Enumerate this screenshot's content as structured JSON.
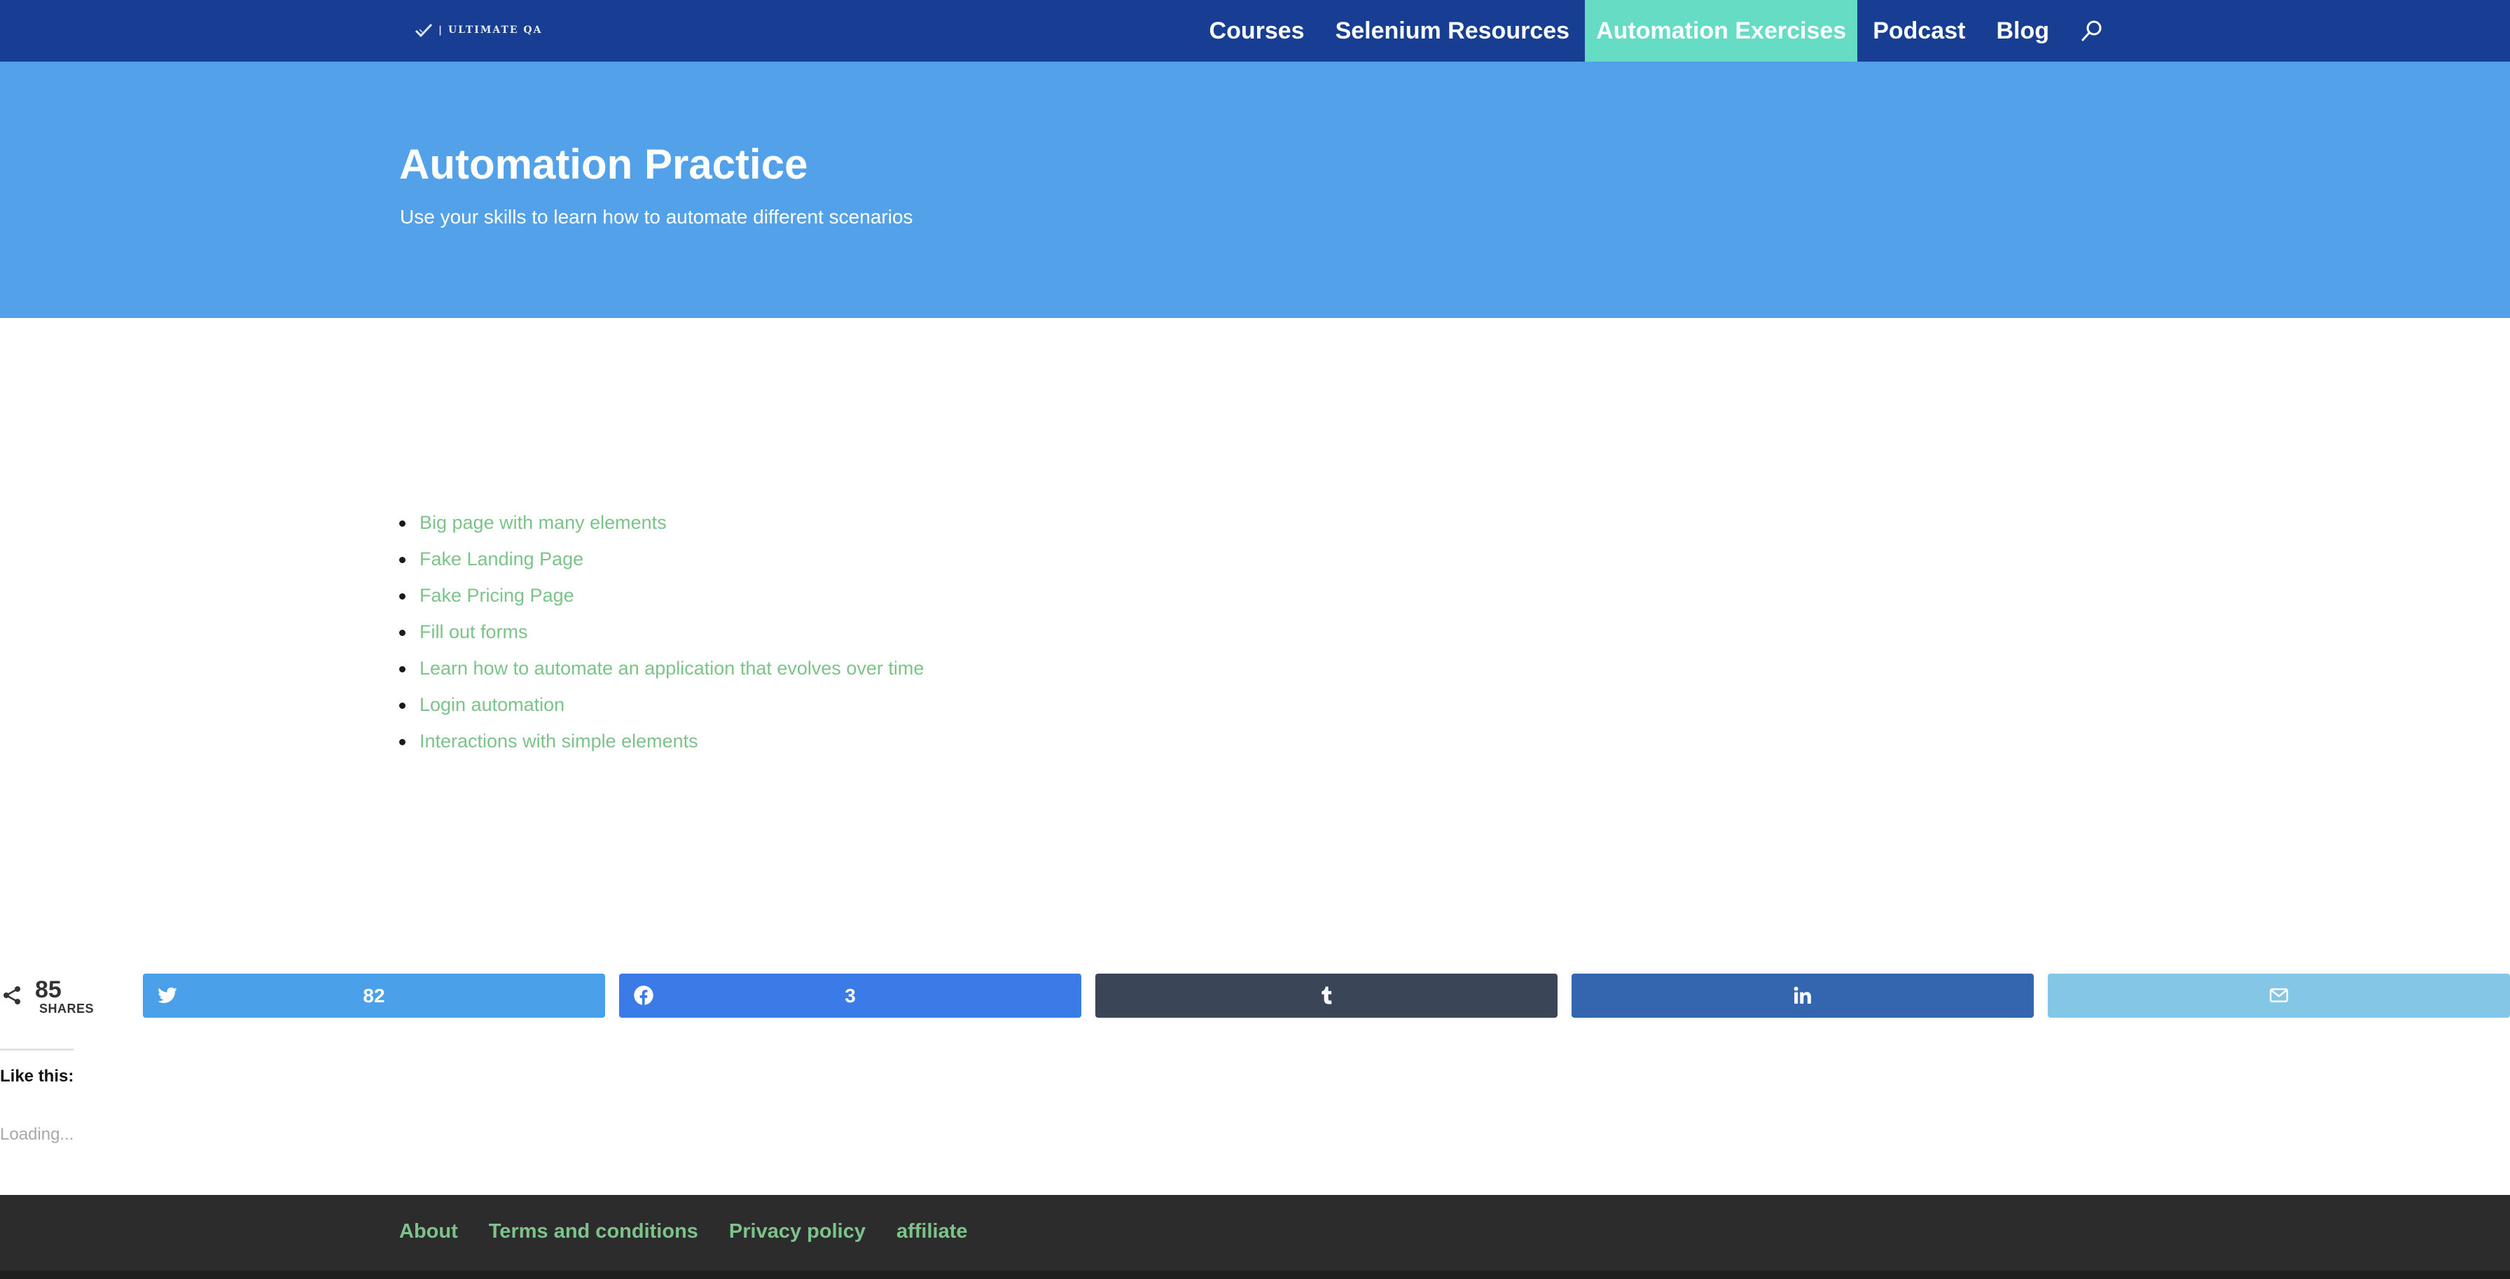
{
  "header": {
    "logo_text": "| ULTIMATE QA",
    "nav": [
      "Courses",
      "Selenium Resources",
      "Automation Exercises",
      "Podcast",
      "Blog"
    ],
    "active_nav": "Automation Exercises"
  },
  "hero": {
    "title": "Automation Practice",
    "subtitle": "Use your skills to learn how to automate different scenarios"
  },
  "links": [
    "Big page with many elements",
    "Fake Landing Page",
    "Fake Pricing Page",
    "Fill out forms",
    "Learn how to automate an application that evolves over time",
    "Login automation",
    "Interactions with simple elements"
  ],
  "share": {
    "total": "85",
    "label": "SHARES",
    "buttons": [
      {
        "network": "twitter",
        "icon": "twitter-icon",
        "count": "82",
        "color": "#4ba0ea"
      },
      {
        "network": "facebook",
        "icon": "facebook-icon",
        "count": "3",
        "color": "#3a7be8"
      },
      {
        "network": "tumblr",
        "icon": "tumblr-icon",
        "count": "",
        "color": "#3a4558"
      },
      {
        "network": "linkedin",
        "icon": "linkedin-icon",
        "count": "",
        "color": "#3466b0"
      },
      {
        "network": "email",
        "icon": "email-icon",
        "count": "",
        "color": "#84c6e6"
      }
    ]
  },
  "like": {
    "title": "Like this:",
    "loading": "Loading..."
  },
  "footer": {
    "links": [
      "About",
      "Terms and conditions",
      "Privacy policy",
      "affiliate"
    ]
  },
  "colors": {
    "header_bg": "#173e93",
    "hero_bg": "#53a2e9",
    "active_nav_bg": "#66dcc4",
    "link_green": "#7cc38a",
    "footer_bg": "#2c2c2c"
  }
}
